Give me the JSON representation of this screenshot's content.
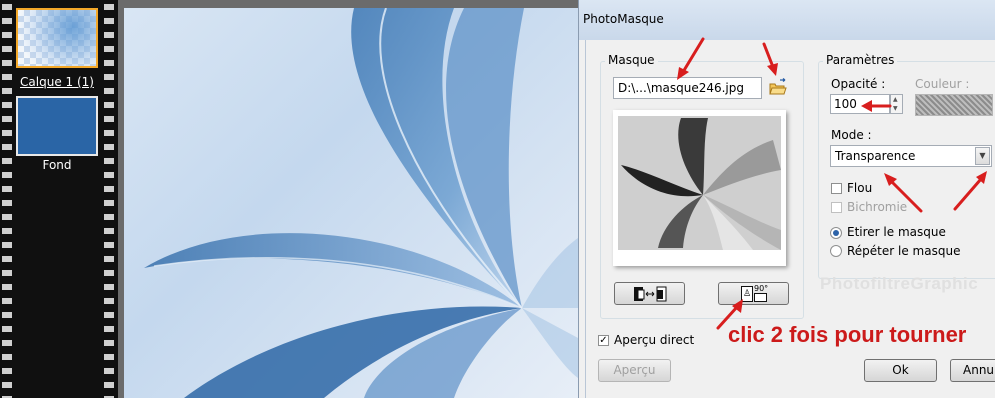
{
  "layers": {
    "items": [
      {
        "label": "Calque 1 (1)",
        "selected": true
      },
      {
        "label": "Fond",
        "selected": false
      }
    ]
  },
  "dialog": {
    "title": "PhotoMasque",
    "masque": {
      "group_title": "Masque",
      "file_path": "D:\\...\\masque246.jpg",
      "browse_icon": "folder-open-icon",
      "invert_icon": "invert-mask-icon",
      "rotate_icon": "rotate-flip-icon",
      "rotate_badge": "90°"
    },
    "params": {
      "group_title": "Paramètres",
      "opacity_label": "Opacité :",
      "opacity_value": "100",
      "color_label": "Couleur :",
      "mode_label": "Mode :",
      "mode_value": "Transparence",
      "flou_label": "Flou",
      "flou_checked": false,
      "bichromie_label": "Bichromie",
      "stretch_label": "Etirer le masque",
      "repeat_label": "Répéter le masque",
      "selected_fit": "Etirer le masque"
    },
    "preview_label": "Aperçu direct",
    "preview_checked": true,
    "apercu_button": "Aperçu",
    "ok_button": "Ok",
    "cancel_button": "Annul"
  },
  "watermark": "PhotofiltreGraphic",
  "annotation": "clic 2 fois pour tourner",
  "colors": {
    "annotation": "#cc1a1a",
    "selection": "#f4a92a",
    "fond": "#2a65a6"
  }
}
